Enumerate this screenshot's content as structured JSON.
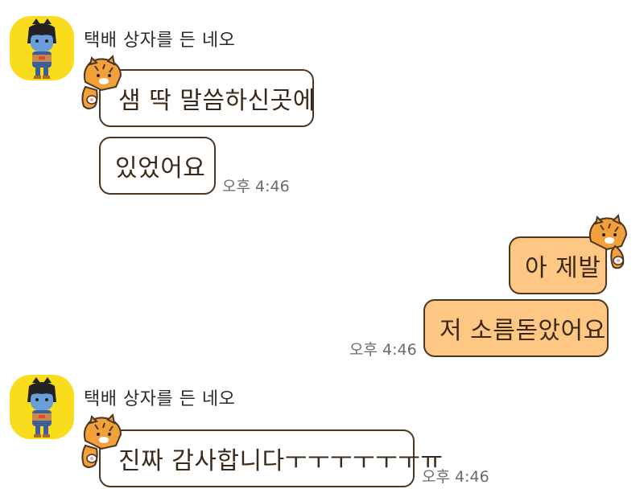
{
  "messages": [
    {
      "sender": "택배 상자를 든 네오",
      "bubbles": [
        "샘 딱 말씀하신곳에",
        "있었어요"
      ],
      "time": "오후 4:46"
    },
    {
      "sender": "me",
      "bubbles": [
        "아 제발",
        "저 소름돋았어요"
      ],
      "time": "오후 4:46"
    },
    {
      "sender": "택배 상자를 든 네오",
      "bubbles": [
        "진짜 감사합니다ㅜㅜㅜㅜㅜㅜㅠ"
      ],
      "time": "오후 4:46"
    }
  ],
  "colors": {
    "incoming_bubble": "#ffffff",
    "outgoing_bubble": "#ffc784",
    "bubble_border": "#4a3622",
    "avatar_bg": "#f9dd1d",
    "time_text": "#6b6b6b"
  },
  "icons": {
    "avatar": "neo-character-holding-box-icon",
    "sticker_deco": "tiger-sticker-icon"
  }
}
